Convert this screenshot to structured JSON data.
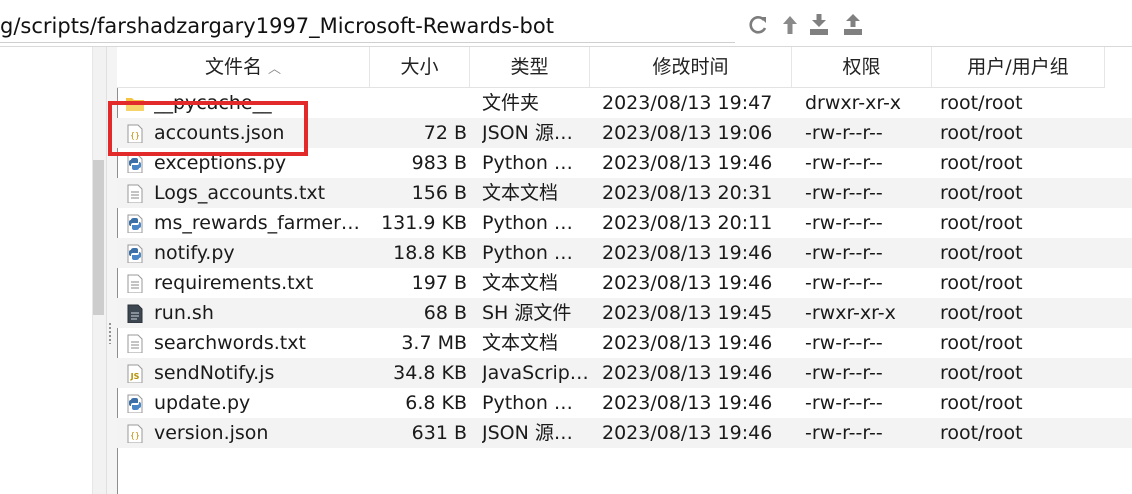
{
  "pathbar": {
    "path": "g/scripts/farshadzargary1997_Microsoft-Rewards-bot",
    "tools": [
      {
        "icon": "refresh-icon"
      },
      {
        "icon": "go-up-icon"
      },
      {
        "icon": "download-icon"
      },
      {
        "icon": "upload-icon"
      }
    ]
  },
  "columns": {
    "name": "文件名",
    "size": "大小",
    "type": "类型",
    "modified": "修改时间",
    "permissions": "权限",
    "owner": "用户/用户组"
  },
  "files": [
    {
      "name": "__pycache__",
      "size": "",
      "type": "文件夹",
      "modified": "2023/08/13 19:47",
      "permissions": "drwxr-xr-x",
      "owner": "root/root",
      "icon": "folder-icon"
    },
    {
      "name": "accounts.json",
      "size": "72 B",
      "type": "JSON 源…",
      "modified": "2023/08/13 19:06",
      "permissions": "-rw-r--r--",
      "owner": "root/root",
      "icon": "json-file-icon"
    },
    {
      "name": "exceptions.py",
      "size": "983 B",
      "type": "Python …",
      "modified": "2023/08/13 19:46",
      "permissions": "-rw-r--r--",
      "owner": "root/root",
      "icon": "python-file-icon"
    },
    {
      "name": "Logs_accounts.txt",
      "size": "156 B",
      "type": "文本文档",
      "modified": "2023/08/13 20:31",
      "permissions": "-rw-r--r--",
      "owner": "root/root",
      "icon": "text-file-icon"
    },
    {
      "name": "ms_rewards_farmer…",
      "size": "131.9 KB",
      "type": "Python …",
      "modified": "2023/08/13 20:11",
      "permissions": "-rw-r--r--",
      "owner": "root/root",
      "icon": "python-file-icon"
    },
    {
      "name": "notify.py",
      "size": "18.8 KB",
      "type": "Python …",
      "modified": "2023/08/13 19:46",
      "permissions": "-rw-r--r--",
      "owner": "root/root",
      "icon": "python-file-icon"
    },
    {
      "name": "requirements.txt",
      "size": "197 B",
      "type": "文本文档",
      "modified": "2023/08/13 19:46",
      "permissions": "-rw-r--r--",
      "owner": "root/root",
      "icon": "text-file-icon"
    },
    {
      "name": "run.sh",
      "size": "68 B",
      "type": "SH 源文件",
      "modified": "2023/08/13 19:45",
      "permissions": "-rwxr-xr-x",
      "owner": "root/root",
      "icon": "shell-file-icon"
    },
    {
      "name": "searchwords.txt",
      "size": "3.7 MB",
      "type": "文本文档",
      "modified": "2023/08/13 19:46",
      "permissions": "-rw-r--r--",
      "owner": "root/root",
      "icon": "text-file-icon"
    },
    {
      "name": "sendNotify.js",
      "size": "34.8 KB",
      "type": "JavaScrip…",
      "modified": "2023/08/13 19:46",
      "permissions": "-rw-r--r--",
      "owner": "root/root",
      "icon": "js-file-icon"
    },
    {
      "name": "update.py",
      "size": "6.8 KB",
      "type": "Python …",
      "modified": "2023/08/13 19:46",
      "permissions": "-rw-r--r--",
      "owner": "root/root",
      "icon": "python-file-icon"
    },
    {
      "name": "version.json",
      "size": "631 B",
      "type": "JSON 源…",
      "modified": "2023/08/13 19:46",
      "permissions": "-rw-r--r--",
      "owner": "root/root",
      "icon": "json-file-icon"
    }
  ],
  "colors": {
    "row_alt": "#f3f3f3",
    "annotation": "#e32a2a",
    "icon_blue": "#3b6fa6",
    "folder": "#f5c542"
  },
  "annotation": {
    "highlighted_file": "accounts.json"
  }
}
